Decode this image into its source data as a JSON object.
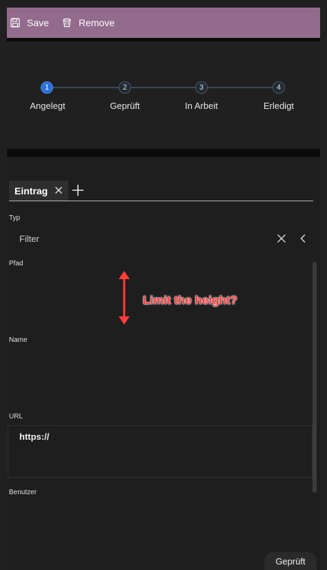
{
  "toolbar": {
    "save_label": "Save",
    "remove_label": "Remove",
    "background": "#936b8c"
  },
  "stepper": {
    "steps": [
      {
        "number": "1",
        "label": "Angelegt",
        "active": true
      },
      {
        "number": "2",
        "label": "Geprüft",
        "active": false
      },
      {
        "number": "3",
        "label": "In Arbeit",
        "active": false
      },
      {
        "number": "4",
        "label": "Erledigt",
        "active": false
      }
    ],
    "active_color": "#2b6fd6"
  },
  "tabs": [
    {
      "label": "Eintrag"
    }
  ],
  "form": {
    "typ": {
      "label": "Typ",
      "placeholder": "Filter"
    },
    "pfad": {
      "label": "Pfad"
    },
    "name": {
      "label": "Name"
    },
    "url": {
      "label": "URL",
      "value": "https://"
    },
    "benutzer": {
      "label": "Benutzer"
    }
  },
  "annotation": {
    "text": "Limit the height?",
    "color": "#ff3b3b"
  },
  "status_button": {
    "label": "Geprüft"
  }
}
